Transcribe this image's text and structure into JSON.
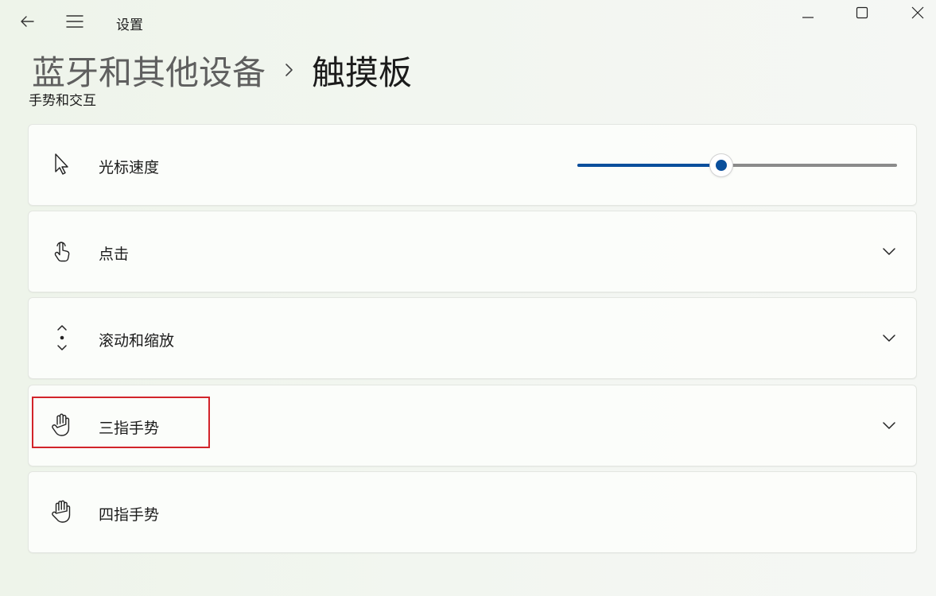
{
  "window": {
    "app_title": "设置",
    "back_icon": "back-arrow-icon",
    "menu_icon": "hamburger-menu-icon",
    "controls": [
      "minimize-icon",
      "maximize-icon",
      "close-icon"
    ]
  },
  "breadcrumb": {
    "parent": "蓝牙和其他设备",
    "separator_icon": "chevron-right-icon",
    "current": "触摸板"
  },
  "section": {
    "title": "手势和交互"
  },
  "items": [
    {
      "label": "光标速度",
      "icon": "pointer-icon",
      "control": "slider"
    },
    {
      "label": "点击",
      "icon": "tap-hand-icon",
      "control": "chevron-down-icon"
    },
    {
      "label": "滚动和缩放",
      "icon": "scroll-icon",
      "control": "chevron-down-icon"
    },
    {
      "label": "三指手势",
      "icon": "three-finger-hand-icon",
      "control": "chevron-down-icon",
      "highlighted": true
    },
    {
      "label": "四指手势",
      "icon": "four-finger-hand-icon",
      "control": "none"
    }
  ],
  "cursor_speed": {
    "value_fraction": 0.45
  },
  "colors": {
    "accent": "#0a4f9c",
    "highlight_border": "#d2242a",
    "track": "#8b8b8b"
  }
}
